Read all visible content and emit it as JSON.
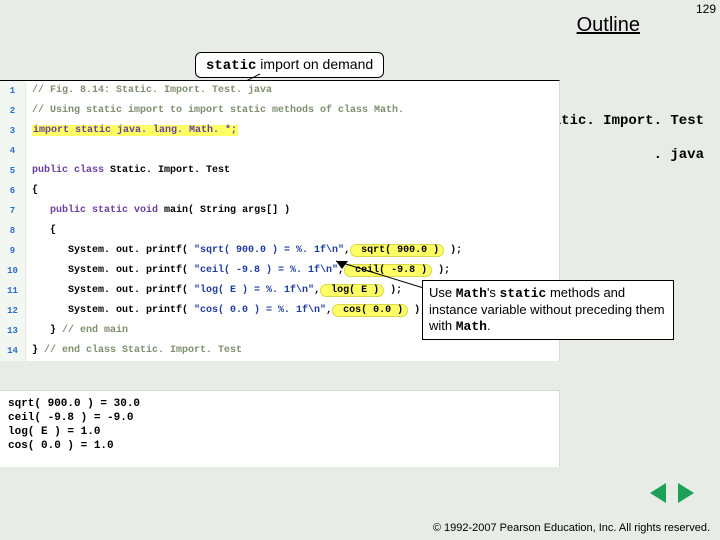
{
  "page_number": "129",
  "outline_label": "Outline",
  "callout_top": {
    "static_kw": "static",
    "rest": " import on demand"
  },
  "right_labels": {
    "classname": "Static. Import. Test",
    "ext": ". java"
  },
  "code": {
    "l1": "// Fig. 8.14: Static. Import. Test. java",
    "l2": "// Using static import to import static methods of class Math.",
    "l3": "import static java. lang. Math. *;",
    "l5a": "public class",
    "l5b": " Static. Import. Test",
    "l6": "{",
    "l7a": "   public static void",
    "l7b": " main(",
    "l7c": " String",
    "l7d": " args[] )",
    "l8": "   {",
    "l9a": "      System. out. printf(",
    "l9b": " \"sqrt( 900.0 ) = %. 1f\\n\"",
    "l9c": ",",
    "l9d": " sqrt( 900.0 )",
    "l9e": " );",
    "l10a": "      System. out. printf(",
    "l10b": " \"ceil( -9.8 ) = %. 1f\\n\"",
    "l10c": ",",
    "l10d": " ceil( -9.8 )",
    "l10e": " );",
    "l11a": "      System. out. printf(",
    "l11b": " \"log( E ) = %. 1f\\n\"",
    "l11c": ",",
    "l11d": " log( E )",
    "l11e": " );",
    "l12a": "      System. out. printf(",
    "l12b": " \"cos( 0.0 ) = %. 1f\\n\"",
    "l12c": ",",
    "l12d": " cos( 0.0 )",
    "l12e": " );",
    "l13a": "   }",
    "l13b": " // end main",
    "l14a": "}",
    "l14b": " // end class Static. Import. Test"
  },
  "output": {
    "o1": "sqrt( 900.0 ) = 30.0",
    "o2": "ceil( -9.8 ) = -9.0",
    "o3": "log( E ) = 1.0",
    "o4": "cos( 0.0 ) = 1.0"
  },
  "callout_main": {
    "pre": "Use ",
    "math": "Math",
    "mid1": "'s ",
    "static": "static",
    "mid2": " methods and instance variable without preceding them with ",
    "math2": "Math",
    "end": "."
  },
  "copyright": "© 1992-2007 Pearson Education, Inc.  All rights reserved."
}
